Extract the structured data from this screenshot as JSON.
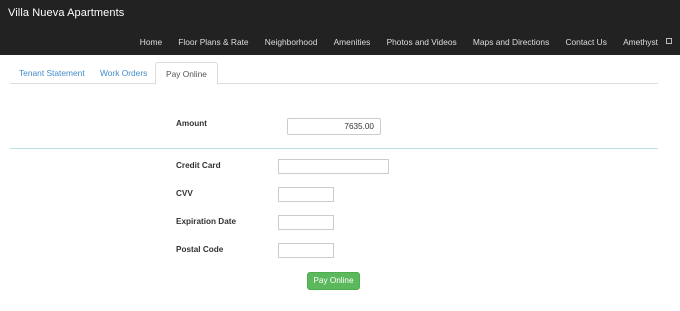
{
  "app": {
    "brand": "Villa Nueva Apartments"
  },
  "nav": {
    "links": [
      "Home",
      "Floor Plans & Rate",
      "Neighborhood",
      "Amenities",
      "Photos and Videos",
      "Maps and Directions",
      "Contact Us",
      "Amethyst"
    ]
  },
  "tabs": [
    {
      "label": "Tenant Statement",
      "active": false
    },
    {
      "label": "Work Orders",
      "active": false
    },
    {
      "label": "Pay Online",
      "active": true
    }
  ],
  "form": {
    "amount_label": "Amount",
    "amount_value": "7635.00",
    "credit_card_label": "Credit Card",
    "credit_card_value": "",
    "cvv_label": "CVV",
    "cvv_value": "",
    "expiration_label": "Expiration Date",
    "expiration_value": "",
    "postal_label": "Postal Code",
    "postal_value": "",
    "submit_label": "Pay Online"
  },
  "colors": {
    "navbar": "#222222",
    "link": "#428bca",
    "submit": "#5cb85c",
    "divider": "#bfe0ea"
  }
}
